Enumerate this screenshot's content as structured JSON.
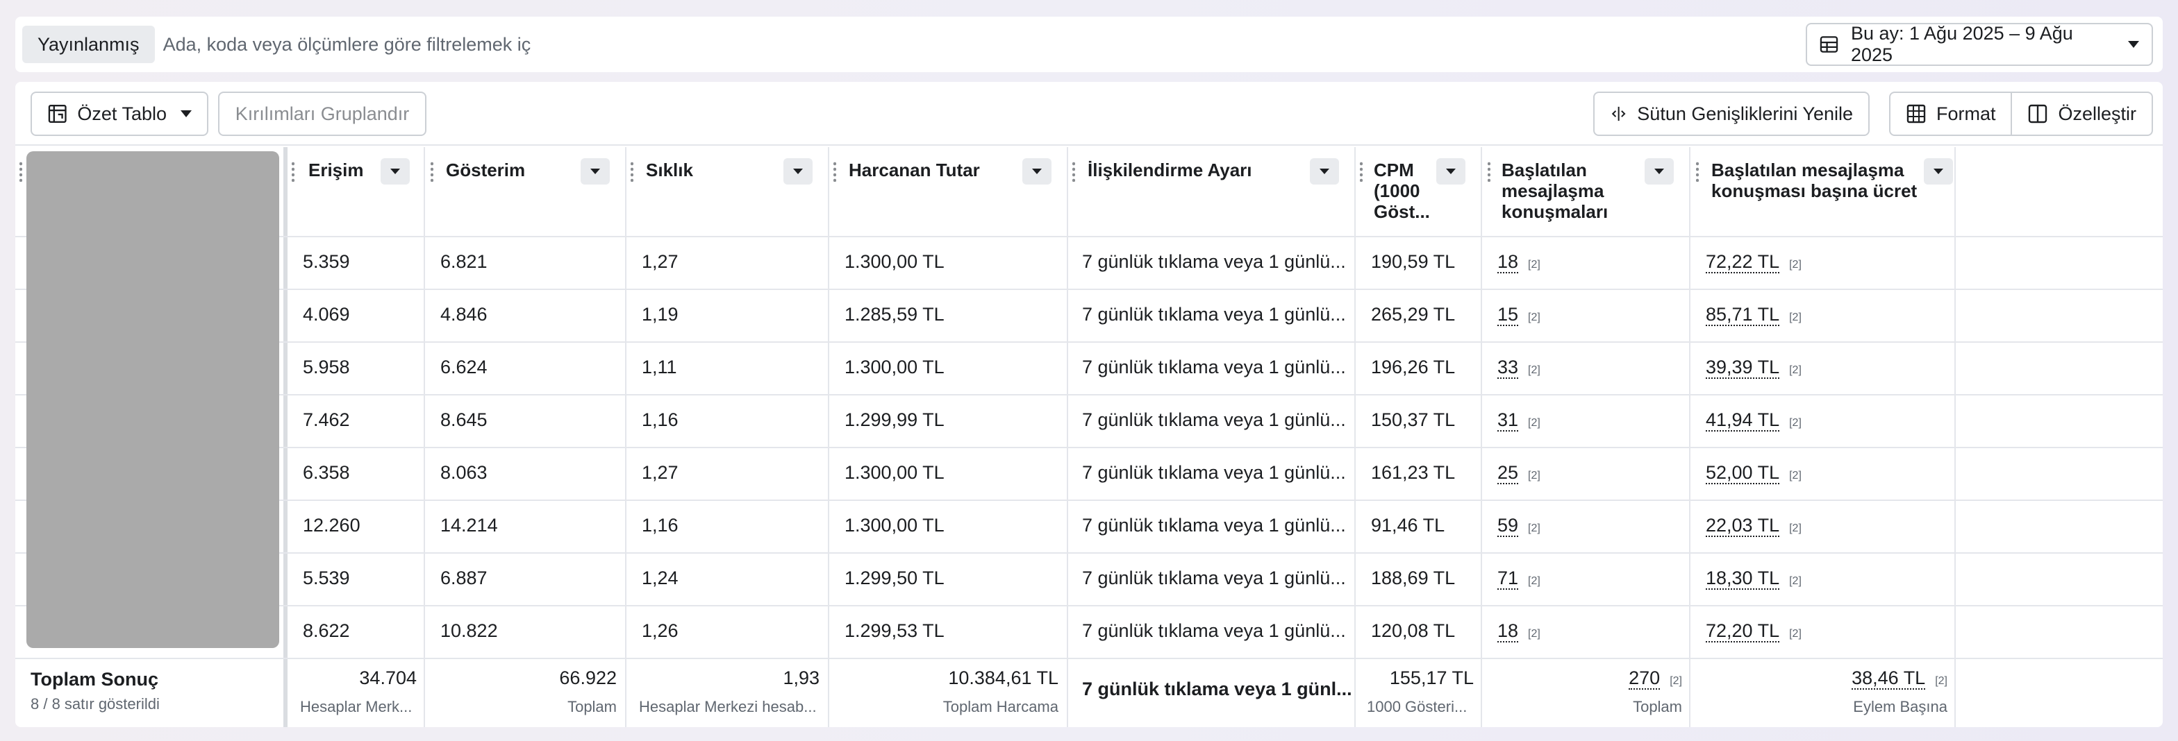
{
  "filter": {
    "chip_label": "Yayınlanmış",
    "search_placeholder": "Ada, koda veya ölçümlere göre filtrelemek iç",
    "date_label": "Bu ay: 1 Ağu 2025 – 9 Ağu 2025"
  },
  "toolbar": {
    "pivot_label": "Özet Tablo",
    "group_label": "Kırılımları Gruplandır",
    "reset_widths_label": "Sütun Genişliklerini Yenile",
    "format_label": "Format",
    "customize_label": "Özelleştir"
  },
  "columns": [
    {
      "key": "reach",
      "label": "Erişim"
    },
    {
      "key": "impressions",
      "label": "Gösterim"
    },
    {
      "key": "frequency",
      "label": "Sıklık"
    },
    {
      "key": "spend",
      "label": "Harcanan Tutar"
    },
    {
      "key": "attribution",
      "label": "İlişkilendirme Ayarı"
    },
    {
      "key": "cpm",
      "label": "CPM (1000 Göst..."
    },
    {
      "key": "conversations",
      "label": "Başlatılan mesajlaşma konuşmaları"
    },
    {
      "key": "cost_per_conversation",
      "label": "Başlatılan mesajlaşma konuşması başına ücret"
    }
  ],
  "rows": [
    {
      "reach": "5.359",
      "impressions": "6.821",
      "frequency": "1,27",
      "spend": "1.300,00 TL",
      "attribution": "7 günlük tıklama veya 1 günlü...",
      "cpm": "190,59 TL",
      "conversations": "18",
      "cost_per_conversation": "72,22 TL"
    },
    {
      "reach": "4.069",
      "impressions": "4.846",
      "frequency": "1,19",
      "spend": "1.285,59 TL",
      "attribution": "7 günlük tıklama veya 1 günlü...",
      "cpm": "265,29 TL",
      "conversations": "15",
      "cost_per_conversation": "85,71 TL"
    },
    {
      "reach": "5.958",
      "impressions": "6.624",
      "frequency": "1,11",
      "spend": "1.300,00 TL",
      "attribution": "7 günlük tıklama veya 1 günlü...",
      "cpm": "196,26 TL",
      "conversations": "33",
      "cost_per_conversation": "39,39 TL"
    },
    {
      "reach": "7.462",
      "impressions": "8.645",
      "frequency": "1,16",
      "spend": "1.299,99 TL",
      "attribution": "7 günlük tıklama veya 1 günlü...",
      "cpm": "150,37 TL",
      "conversations": "31",
      "cost_per_conversation": "41,94 TL"
    },
    {
      "reach": "6.358",
      "impressions": "8.063",
      "frequency": "1,27",
      "spend": "1.300,00 TL",
      "attribution": "7 günlük tıklama veya 1 günlü...",
      "cpm": "161,23 TL",
      "conversations": "25",
      "cost_per_conversation": "52,00 TL"
    },
    {
      "reach": "12.260",
      "impressions": "14.214",
      "frequency": "1,16",
      "spend": "1.300,00 TL",
      "attribution": "7 günlük tıklama veya 1 günlü...",
      "cpm": "91,46 TL",
      "conversations": "59",
      "cost_per_conversation": "22,03 TL"
    },
    {
      "reach": "5.539",
      "impressions": "6.887",
      "frequency": "1,24",
      "spend": "1.299,50 TL",
      "attribution": "7 günlük tıklama veya 1 günlü...",
      "cpm": "188,69 TL",
      "conversations": "71",
      "cost_per_conversation": "18,30 TL"
    },
    {
      "reach": "8.622",
      "impressions": "10.822",
      "frequency": "1,26",
      "spend": "1.299,53 TL",
      "attribution": "7 günlük tıklama veya 1 günlü...",
      "cpm": "120,08 TL",
      "conversations": "18",
      "cost_per_conversation": "72,20 TL"
    }
  ],
  "note_marker": "[2]",
  "totals": {
    "title": "Toplam Sonuç",
    "subtitle": "8 / 8 satır gösterildi",
    "reach": "34.704",
    "reach_sub": "Hesaplar Merk...",
    "impressions": "66.922",
    "impressions_sub": "Toplam",
    "frequency": "1,93",
    "frequency_sub": "Hesaplar Merkezi hesab...",
    "spend": "10.384,61 TL",
    "spend_sub": "Toplam Harcama",
    "attribution": "7 günlük tıklama veya 1 günl...",
    "cpm": "155,17 TL",
    "cpm_sub": "1000 Gösteri...",
    "conversations": "270",
    "conversations_sub": "Toplam",
    "cost_per_conversation": "38,46 TL",
    "cost_per_conversation_sub": "Eylem Başına"
  },
  "icons": {
    "pivot": "pivot-table-icon",
    "date": "calendar-table-icon",
    "reset": "column-resize-icon",
    "format": "format-grid-icon",
    "customize": "panel-layout-icon"
  }
}
